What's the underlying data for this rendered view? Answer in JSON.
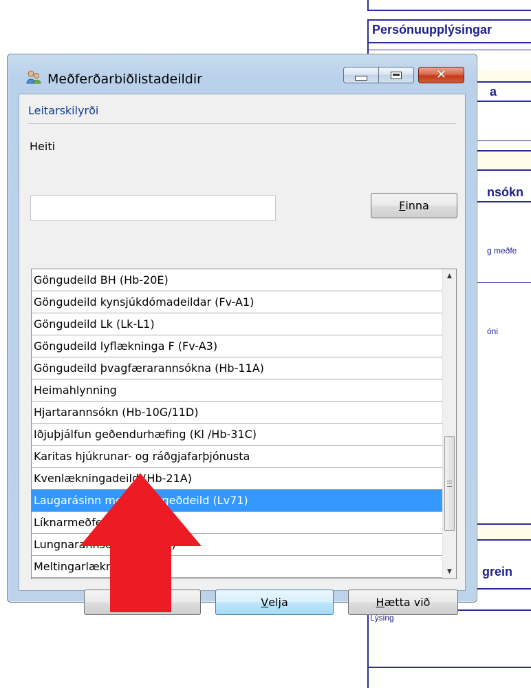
{
  "window": {
    "title": "Meðferðarbiðlistadeildir",
    "icon": "users-icon",
    "controls": {
      "minimize": "minimize-icon",
      "maximize": "maximize-icon",
      "close_glyph": "✕"
    }
  },
  "search": {
    "group_label": "Leitarskilyrði",
    "field_label": "Heiti",
    "value": "",
    "placeholder": "",
    "find_button": {
      "accel": "F",
      "rest": "inna"
    }
  },
  "list": {
    "items": [
      "Göngudeild BH (Hb-20E)",
      "Göngudeild kynsjúkdómadeildar (Fv-A1)",
      "Göngudeild Lk (Lk-L1)",
      "Göngudeild lyflækninga F (Fv-A3)",
      "Göngudeild þvagfærarannsókna (Hb-11A)",
      "Heimahlynning",
      "Hjartarannsókn (Hb-10G/11D)",
      "Iðjuþjálfun geðendurhæfing (Kl /Hb-31C)",
      "Karitas hjúkrunar- og ráðgjafarþjónusta",
      "Kvenlækningadeild (Hb-21A)",
      "Laugarásinn meðferðargeðdeild (Lv71)",
      "Líknarmeðferð",
      "Lungnarannsóknir (Fv-A3)",
      "Meltingarlækningar"
    ],
    "selected_index": 10
  },
  "buttons": {
    "hidden_label": "",
    "select": {
      "accel": "V",
      "rest": "elja"
    },
    "cancel": {
      "accel": "H",
      "rest": "ætta við"
    }
  },
  "background_form": {
    "section_title": "Persónuupplýsingar",
    "frag_a": "a",
    "frag_rannsokn": "nsókn",
    "frag_medfe": "g meðfe",
    "frag_oni": "óni",
    "frag_grein": "grein",
    "hash": "#",
    "lysing": "Lýsing"
  },
  "colors": {
    "selection": "#3399ff",
    "form_border": "#2b2b99",
    "form_text": "#1e1e8a",
    "annotation_arrow": "#ed1c24"
  }
}
